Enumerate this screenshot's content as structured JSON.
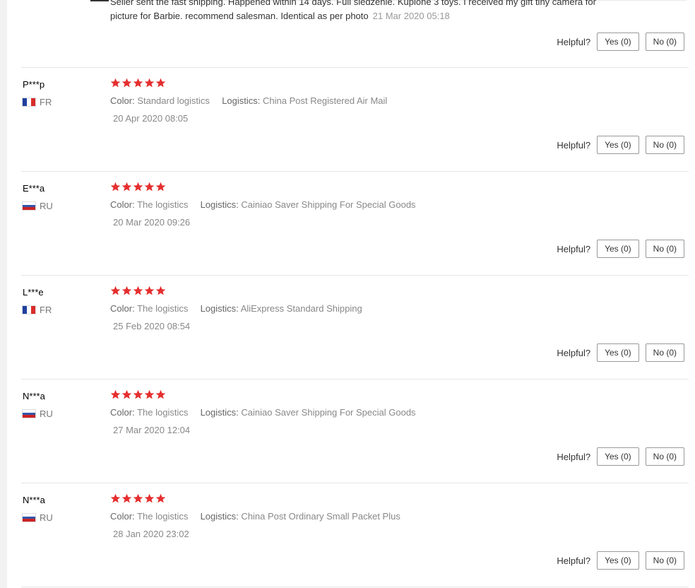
{
  "partial_review": {
    "line1": "Seller sent the fast shipping. Happened within 14 days. Full siedzenie. Kupione 3 toys. I received my gift tiny camera for",
    "line2": "picture for Barbie. recommend salesman. Identical as per photo",
    "date": "21 Mar 2020 05:18",
    "helpful_label": "Helpful?",
    "yes_label": "Yes (0)",
    "no_label": "No (0)"
  },
  "labels": {
    "color": "Color:",
    "logistics": "Logistics:"
  },
  "colors": {
    "star": "#e62e2e",
    "fr_flag": [
      "#1f3f9e",
      "#ffffff",
      "#d92b2b"
    ],
    "ru_flag": [
      "#ffffff",
      "#3355aa",
      "#cc2222"
    ]
  },
  "reviews": [
    {
      "user": "P***p",
      "country": "FR",
      "flag": "fr",
      "stars": 5,
      "color": "Standard logistics",
      "logistics": "China Post Registered Air Mail",
      "date": "20 Apr 2020 08:05",
      "helpful_label": "Helpful?",
      "yes_label": "Yes (0)",
      "no_label": "No (0)"
    },
    {
      "user": "E***a",
      "country": "RU",
      "flag": "ru",
      "stars": 5,
      "color": "The logistics",
      "logistics": "Cainiao Saver Shipping For Special Goods",
      "date": "20 Mar 2020 09:26",
      "helpful_label": "Helpful?",
      "yes_label": "Yes (0)",
      "no_label": "No (0)"
    },
    {
      "user": "L***e",
      "country": "FR",
      "flag": "fr",
      "stars": 5,
      "color": "The logistics",
      "logistics": "AliExpress Standard Shipping",
      "date": "25 Feb 2020 08:54",
      "helpful_label": "Helpful?",
      "yes_label": "Yes (0)",
      "no_label": "No (0)"
    },
    {
      "user": "N***a",
      "country": "RU",
      "flag": "ru",
      "stars": 5,
      "color": "The logistics",
      "logistics": "Cainiao Saver Shipping For Special Goods",
      "date": "27 Mar 2020 12:04",
      "helpful_label": "Helpful?",
      "yes_label": "Yes (0)",
      "no_label": "No (0)"
    },
    {
      "user": "N***a",
      "country": "RU",
      "flag": "ru",
      "stars": 5,
      "color": "The logistics",
      "logistics": "China Post Ordinary Small Packet Plus",
      "date": "28 Jan 2020 23:02",
      "helpful_label": "Helpful?",
      "yes_label": "Yes (0)",
      "no_label": "No (0)"
    }
  ]
}
